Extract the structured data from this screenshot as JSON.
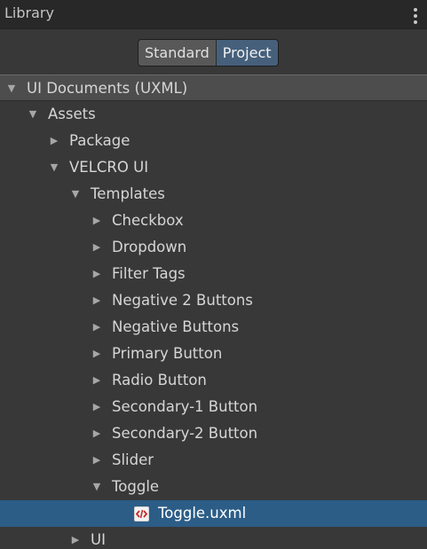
{
  "header": {
    "title": "Library"
  },
  "view_toggle": {
    "standard_label": "Standard",
    "project_label": "Project",
    "selected": "Project"
  },
  "tree": {
    "root": {
      "label": "UI Documents (UXML)",
      "expanded": true
    },
    "assets": {
      "label": "Assets",
      "expanded": true
    },
    "package": {
      "label": "Package",
      "expanded": false
    },
    "velcro": {
      "label": "VELCRO UI",
      "expanded": true
    },
    "templates": {
      "label": "Templates",
      "expanded": true
    },
    "checkbox": {
      "label": "Checkbox"
    },
    "dropdown": {
      "label": "Dropdown"
    },
    "filter_tags": {
      "label": "Filter Tags"
    },
    "negative_2_buttons": {
      "label": "Negative 2 Buttons"
    },
    "negative_buttons": {
      "label": "Negative Buttons"
    },
    "primary_button": {
      "label": "Primary Button"
    },
    "radio_button": {
      "label": "Radio Button"
    },
    "secondary_1_button": {
      "label": "Secondary-1 Button"
    },
    "secondary_2_button": {
      "label": "Secondary-2 Button"
    },
    "slider": {
      "label": "Slider"
    },
    "toggle": {
      "label": "Toggle",
      "expanded": true
    },
    "toggle_uxml": {
      "label": "Toggle.uxml",
      "icon": "uxml-file-icon",
      "selected": true
    },
    "ui": {
      "label": "UI",
      "expanded": false
    }
  },
  "colors": {
    "background": "#383838",
    "header": "#282828",
    "selected_row": "#2c5d87",
    "project_toggle": "#46607c",
    "file_icon_accent": "#c42b2b"
  }
}
